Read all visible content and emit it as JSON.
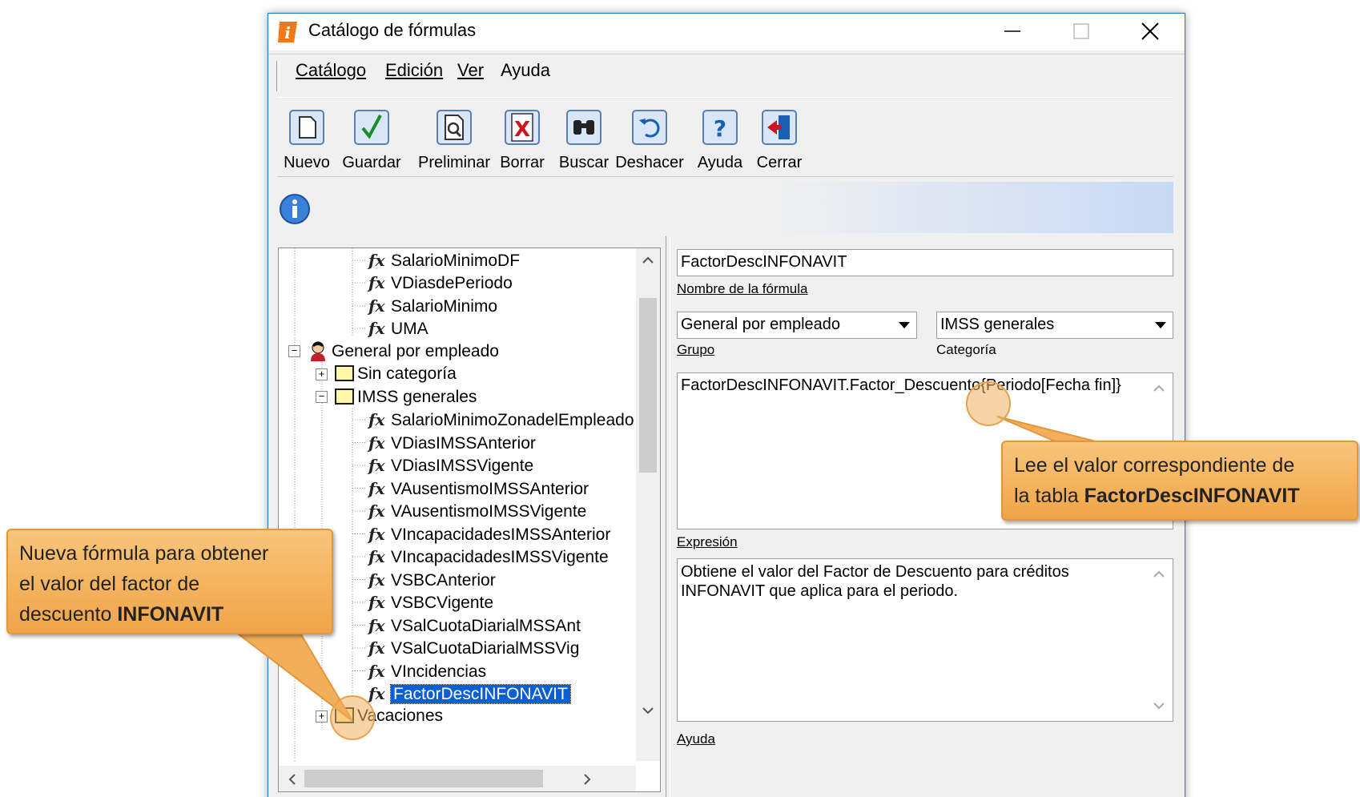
{
  "window": {
    "title": "Catálogo de fórmulas"
  },
  "menu": [
    "Catálogo",
    "Edición",
    "Ver",
    "Ayuda"
  ],
  "toolbar": [
    {
      "label": "Nuevo",
      "icon": "new-document-icon"
    },
    {
      "label": "Guardar",
      "icon": "checkmark-icon"
    },
    {
      "label": "Preliminar",
      "icon": "preview-icon"
    },
    {
      "label": "Borrar",
      "icon": "delete-x-icon"
    },
    {
      "label": "Buscar",
      "icon": "binoculars-icon"
    },
    {
      "label": "Deshacer",
      "icon": "undo-icon"
    },
    {
      "label": "Ayuda",
      "icon": "help-icon"
    },
    {
      "label": "Cerrar",
      "icon": "exit-icon"
    }
  ],
  "tree": {
    "formulas_top": [
      "SalarioMinimoDF",
      "VDiasdePeriodo",
      "SalarioMinimo",
      "UMA"
    ],
    "group": "General por empleado",
    "cat_sin": "Sin categoría",
    "cat_imss": "IMSS generales",
    "formulas_imss": [
      "SalarioMinimoZonadelEmpleado",
      "VDiasIMSSAnterior",
      "VDiasIMSSVigente",
      "VAusentismoIMSSAnterior",
      "VAusentismoIMSSVigente",
      "VIncapacidadesIMSSAnterior",
      "VIncapacidadesIMSSVigente",
      "VSBCAnterior",
      "VSBCVigente",
      "VSalCuotaDiarialMSSAnt",
      "VSalCuotaDiarialMSSVig",
      "VIncidencias"
    ],
    "selected": "FactorDescINFONAVIT",
    "cat_vac": "Vacaciones"
  },
  "form": {
    "name_value": "FactorDescINFONAVIT",
    "name_label": "Nombre de la fórmula",
    "group_value": "General por empleado",
    "group_label": "Grupo",
    "category_value": "IMSS generales",
    "category_label": "Categoría",
    "expression_value": "FactorDescINFONAVIT.Factor_Descuento{Periodo[Fecha fin]}",
    "expression_label": "Expresión",
    "help_value": "Obtiene el valor del Factor de Descuento para créditos INFONAVIT que aplica para el periodo.",
    "help_label": "Ayuda"
  },
  "callouts": {
    "left": {
      "line1": "Nueva fórmula para obtener",
      "line2": "el valor del factor de",
      "line3_pre": "descuento ",
      "line3_bold": "INFONAVIT"
    },
    "right": {
      "line1": "Lee el valor correspondiente de",
      "line2_pre": "la tabla ",
      "line2_bold": "FactorDescINFONAVIT"
    }
  },
  "colors": {
    "accent": "#0a5fd6",
    "callout": "#f0a448",
    "window_border": "#1e74c8"
  }
}
